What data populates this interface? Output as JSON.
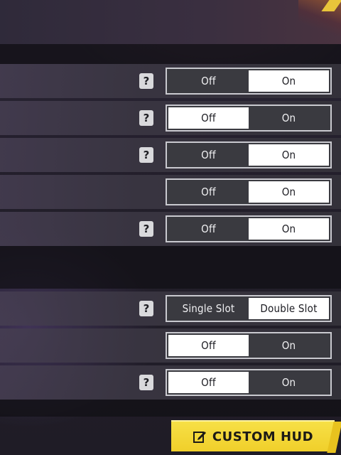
{
  "settings": {
    "rows": [
      {
        "has_help": true,
        "help_glyph": "?",
        "options": [
          "Off",
          "On"
        ],
        "selected": 1
      },
      {
        "has_help": true,
        "help_glyph": "?",
        "options": [
          "Off",
          "On"
        ],
        "selected": 0
      },
      {
        "has_help": true,
        "help_glyph": "?",
        "options": [
          "Off",
          "On"
        ],
        "selected": 1
      },
      {
        "has_help": false,
        "help_glyph": "",
        "options": [
          "Off",
          "On"
        ],
        "selected": 1
      },
      {
        "has_help": true,
        "help_glyph": "?",
        "options": [
          "Off",
          "On"
        ],
        "selected": 1
      },
      {
        "has_help": true,
        "help_glyph": "?",
        "options": [
          "Single Slot",
          "Double Slot"
        ],
        "selected": 1
      },
      {
        "has_help": false,
        "help_glyph": "",
        "options": [
          "Off",
          "On"
        ],
        "selected": 0
      },
      {
        "has_help": true,
        "help_glyph": "?",
        "options": [
          "Off",
          "On"
        ],
        "selected": 0
      }
    ]
  },
  "footer": {
    "custom_hud_label": "CUSTOM HUD",
    "custom_hud_icon": "edit-icon",
    "accent_color": "#f3d338"
  },
  "colors": {
    "toggle_active_bg": "#ffffff",
    "toggle_inactive_bg": "#3a3a40",
    "row_bg": "#3a3640"
  }
}
